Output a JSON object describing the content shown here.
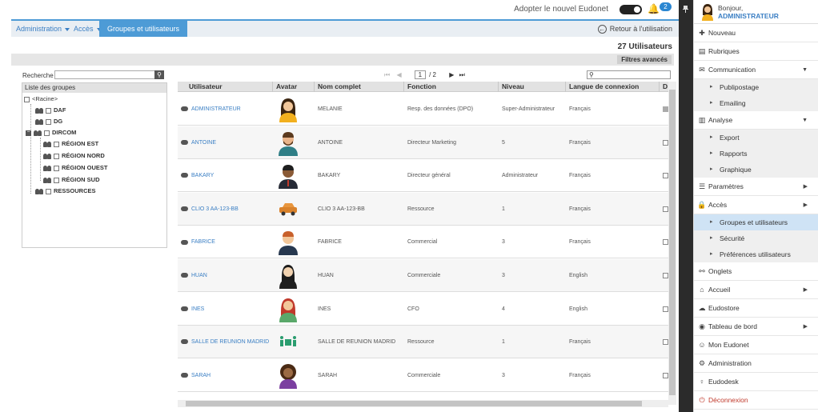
{
  "topbar": {
    "adopt_label": "Adopter le nouvel Eudonet",
    "notif_count": "2"
  },
  "breadcrumb": {
    "items": [
      "Administration",
      "Accès"
    ],
    "active": "Groupes et utilisateurs",
    "back_label": "Retour à l'utilisation"
  },
  "count_label": "27 Utilisateurs",
  "filters_button": "Filtres avancés",
  "tree": {
    "search_label": "Recherche :",
    "header": "Liste des groupes",
    "root": "<Racine>",
    "nodes": [
      "DAF",
      "DG",
      "DIRCOM",
      "RÉGION EST",
      "RÉGION NORD",
      "RÉGION OUEST",
      "RÉGION SUD",
      "RESSOURCES"
    ]
  },
  "pager": {
    "current": "1",
    "total": "/ 2"
  },
  "grid": {
    "columns": [
      "Utilisateur",
      "Avatar",
      "Nom complet",
      "Fonction",
      "Niveau",
      "Langue de connexion",
      "D"
    ],
    "rows": [
      {
        "user": "ADMINISTRATEUR",
        "full": "MELANIE",
        "func": "Resp. des données (DPO)",
        "level": "Super-Administrateur",
        "lang": "Français",
        "avatar": "woman-yellow"
      },
      {
        "user": "ANTOINE",
        "full": "ANTOINE",
        "func": "Directeur Marketing",
        "level": "5",
        "lang": "Français",
        "avatar": "man-beard"
      },
      {
        "user": "BAKARY",
        "full": "BAKARY",
        "func": "Directeur général",
        "level": "Administrateur",
        "lang": "Français",
        "avatar": "man-suit"
      },
      {
        "user": "CLIO 3 AA-123-BB",
        "full": "CLIO 3 AA-123-BB",
        "func": "Ressource",
        "level": "1",
        "lang": "Français",
        "avatar": "car"
      },
      {
        "user": "FABRICE",
        "full": "FABRICE",
        "func": "Commercial",
        "level": "3",
        "lang": "Français",
        "avatar": "man-ginger"
      },
      {
        "user": "HUAN",
        "full": "HUAN",
        "func": "Commerciale",
        "level": "3",
        "lang": "English",
        "avatar": "woman-dark"
      },
      {
        "user": "INES",
        "full": "INES",
        "func": "CFO",
        "level": "4",
        "lang": "English",
        "avatar": "woman-red"
      },
      {
        "user": "SALLE DE REUNION MADRID",
        "full": "SALLE DE REUNION MADRID",
        "func": "Ressource",
        "level": "1",
        "lang": "Français",
        "avatar": "meeting"
      },
      {
        "user": "SARAH",
        "full": "SARAH",
        "func": "Commerciale",
        "level": "3",
        "lang": "Français",
        "avatar": "woman-curly"
      }
    ]
  },
  "panel": {
    "hello": "Bonjour,",
    "username": "ADMINISTRATEUR",
    "menu": [
      {
        "label": "Nouveau",
        "icon": "plus-icon"
      },
      {
        "label": "Rubriques",
        "icon": "rubriques-icon"
      },
      {
        "label": "Communication",
        "icon": "envelope-icon",
        "arrow": "down"
      },
      {
        "label": "Publipostage",
        "sub": true
      },
      {
        "label": "Emailing",
        "sub": true
      },
      {
        "label": "Analyse",
        "icon": "chart-icon",
        "arrow": "down"
      },
      {
        "label": "Export",
        "sub": true
      },
      {
        "label": "Rapports",
        "sub": true
      },
      {
        "label": "Graphique",
        "sub": true
      },
      {
        "label": "Paramètres",
        "icon": "sliders-icon",
        "arrow": "right"
      },
      {
        "label": "Accès",
        "icon": "lock-icon",
        "arrow": "right"
      },
      {
        "label": "Groupes et utilisateurs",
        "sub": true,
        "selected": true
      },
      {
        "label": "Sécurité",
        "sub": true
      },
      {
        "label": "Préférences utilisateurs",
        "sub": true
      },
      {
        "label": "Onglets",
        "icon": "tabs-icon"
      },
      {
        "label": "Accueil",
        "icon": "home-icon",
        "arrow": "right"
      },
      {
        "label": "Eudostore",
        "icon": "cloud-icon"
      },
      {
        "label": "Tableau de bord",
        "icon": "dashboard-icon",
        "arrow": "right"
      },
      {
        "label": "Mon Eudonet",
        "icon": "person-icon"
      },
      {
        "label": "Administration",
        "icon": "gears-icon"
      },
      {
        "label": "Eudodesk",
        "icon": "bulb-icon"
      },
      {
        "label": "Déconnexion",
        "icon": "power-icon",
        "logout": true
      }
    ]
  },
  "colors": {
    "accent": "#4d9bd6",
    "link": "#3b7fc4",
    "selected": "#cfe3f5",
    "logout": "#c0392b"
  }
}
